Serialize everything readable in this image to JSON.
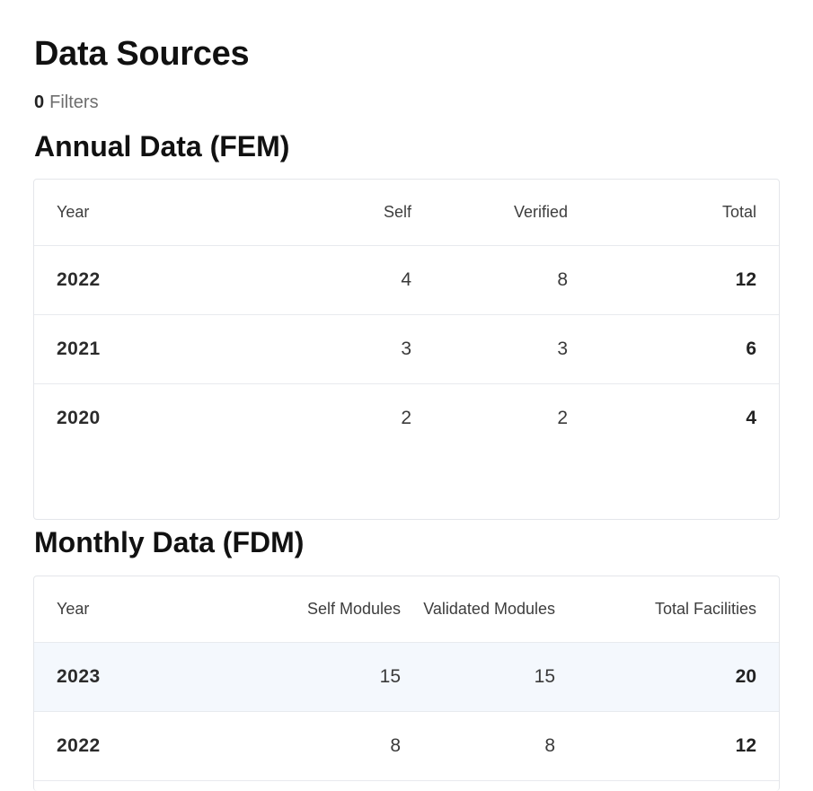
{
  "page": {
    "title": "Data Sources",
    "filters_count": "0",
    "filters_label": "Filters"
  },
  "annual": {
    "title": "Annual Data (FEM)",
    "columns": [
      "Year",
      "Self",
      "Verified",
      "Total"
    ],
    "rows": [
      {
        "year": "2022",
        "self": "4",
        "verified": "8",
        "total": "12"
      },
      {
        "year": "2021",
        "self": "3",
        "verified": "3",
        "total": "6"
      },
      {
        "year": "2020",
        "self": "2",
        "verified": "2",
        "total": "4"
      }
    ]
  },
  "monthly": {
    "title": "Monthly Data (FDM)",
    "columns": [
      "Year",
      "Self Modules",
      "Validated Modules",
      "Total Facilities"
    ],
    "rows": [
      {
        "year": "2023",
        "self": "15",
        "validated": "15",
        "total": "20"
      },
      {
        "year": "2022",
        "self": "8",
        "validated": "8",
        "total": "12"
      }
    ]
  },
  "colors": {
    "highlight_row": "#f4f8fd",
    "border": "#e4e6ea"
  }
}
